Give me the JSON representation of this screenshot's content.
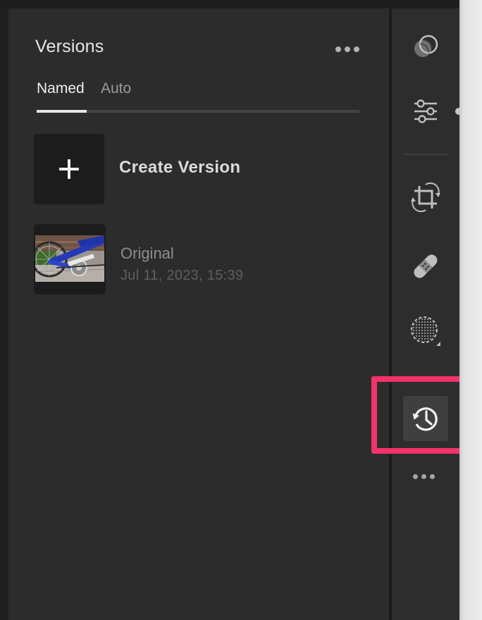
{
  "panel": {
    "title": "Versions",
    "more_icon": "ellipsis-icon"
  },
  "tabs": [
    {
      "label": "Named",
      "active": true
    },
    {
      "label": "Auto",
      "active": false
    }
  ],
  "create_version": {
    "label": "Create Version",
    "icon": "plus-icon"
  },
  "versions": [
    {
      "name": "Original",
      "date": "Jul 11, 2023, 15:39",
      "thumbnail": "bicycle-photo"
    }
  ],
  "toolbar": {
    "tools": [
      {
        "name": "presets-icon",
        "active": false
      },
      {
        "name": "edit-sliders-icon",
        "active": false
      },
      {
        "name": "crop-rotate-icon",
        "active": false
      },
      {
        "name": "healing-bandage-icon",
        "active": false
      },
      {
        "name": "masking-icon",
        "active": false
      },
      {
        "name": "versions-history-icon",
        "active": true
      }
    ],
    "more_icon": "ellipsis-icon"
  },
  "colors": {
    "panel_bg": "#2c2c2c",
    "tile_bg": "#1c1c1c",
    "highlight": "#f5336b"
  }
}
